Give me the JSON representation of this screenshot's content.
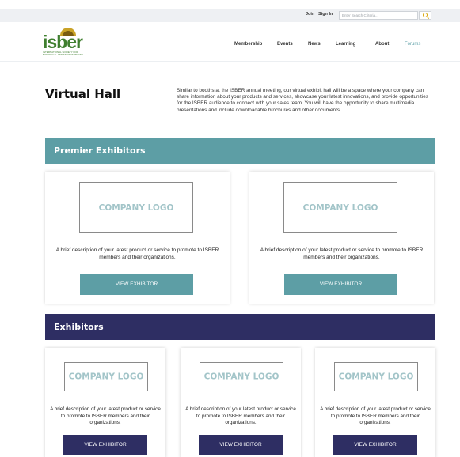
{
  "topbar": {
    "join_label": "Join",
    "signin_label": "Sign In",
    "search_placeholder": "Enter Search Criteria...",
    "search_icon": "search-icon",
    "accent_color": "#d8a300"
  },
  "header": {
    "logo_text": "isber",
    "logo_tagline": "INTERNATIONAL SOCIETY FOR BIOLOGICAL AND ENVIRONMENTAL REPOSITORIES",
    "nav": [
      {
        "label": "Membership"
      },
      {
        "label": "Events"
      },
      {
        "label": "News"
      },
      {
        "label": "Learning"
      },
      {
        "label": "About"
      },
      {
        "label": "Forums"
      }
    ],
    "active_nav": "Forums",
    "brand_color": "#3f7f2f"
  },
  "intro": {
    "title": "Virtual Hall",
    "text": "Similar to booths at the ISBER annual meeting, our virtual exhibit hall will be a space where your company can share information about your products and services, showcase your latest innovations, and provide opportunities for the ISBER audience to connect with your sales team. You will have the opportunity to share multimedia presentations and include downloadable brochures and other documents."
  },
  "premier": {
    "heading": "Premier Exhibitors",
    "color": "#5d9ea5",
    "cards": [
      {
        "logo_text": "COMPANY LOGO",
        "description": "A brief description of your latest product or service to promote to ISBER members and their organizations.",
        "button": "VIEW EXHIBITOR"
      },
      {
        "logo_text": "COMPANY LOGO",
        "description": "A brief description of your latest product or service to promote to ISBER members and their organizations.",
        "button": "VIEW EXHIBITOR"
      }
    ]
  },
  "exhibitors": {
    "heading": "Exhibitors",
    "color": "#2e2e63",
    "cards": [
      {
        "logo_text": "COMPANY LOGO",
        "description": "A brief description of your latest product or service to promote to ISBER members and their organizations.",
        "button": "VIEW EXHIBITOR"
      },
      {
        "logo_text": "COMPANY LOGO",
        "description": "A brief description of your latest product or service to promote to ISBER members and their organizations.",
        "button": "VIEW EXHIBITOR"
      },
      {
        "logo_text": "COMPANY LOGO",
        "description": "A brief description of your latest product or service to promote to ISBER members and their organizations.",
        "button": "VIEW EXHIBITOR"
      }
    ]
  }
}
